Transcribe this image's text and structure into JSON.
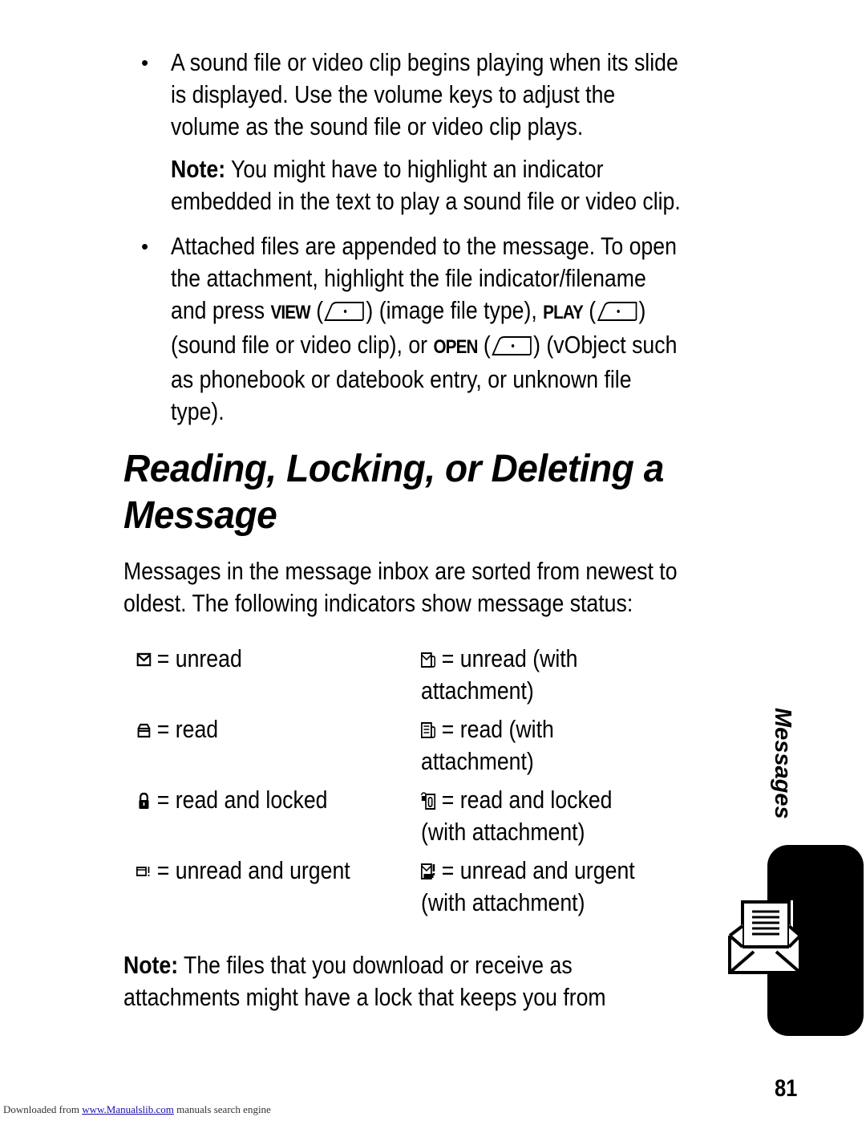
{
  "bullets": [
    {
      "lines": [
        "A sound file or video clip begins playing when its slide",
        "is displayed. Use the volume keys to adjust the",
        "volume as the sound file or video clip plays."
      ],
      "note_label": "Note:",
      "note_lines": [
        " You might have to highlight an indicator",
        "embedded in the text to play a sound file or video clip."
      ]
    },
    {
      "line1": "Attached files are appended to the message. To open",
      "line2": "the attachment, highlight the file indicator/filename",
      "line3_pre": "and press ",
      "view_key": "VIEW",
      "line3_mid": ") (image file type), ",
      "play_key": "PLAY",
      "line4_pre": "(sound file or video clip), or ",
      "open_key": "OPEN",
      "line4_post": ") (vObject such",
      "line5": "as phonebook or datebook entry, or unknown file",
      "line6": "type)."
    }
  ],
  "heading": {
    "line1": "Reading, Locking, or Deleting a",
    "line2": "Message"
  },
  "intro": [
    "Messages in the message inbox are sorted from newest to",
    "oldest. The following indicators show message status:"
  ],
  "indicators": [
    {
      "icon": "unread-envelope-icon",
      "label": "= unread"
    },
    {
      "icon": "unread-attachment-icon",
      "label": "= unread (with",
      "label2": "attachment)"
    },
    {
      "icon": "read-envelope-icon",
      "label": "= read"
    },
    {
      "icon": "read-attachment-icon",
      "label": "= read (with",
      "label2": "attachment)"
    },
    {
      "icon": "lock-icon",
      "label": "= read and locked"
    },
    {
      "icon": "locked-attachment-icon",
      "label": "= read and locked",
      "label2": "(with attachment)"
    },
    {
      "icon": "urgent-envelope-icon",
      "label": "= unread and urgent"
    },
    {
      "icon": "urgent-attachment-icon",
      "label": "= unread and urgent",
      "label2": "(with attachment)"
    }
  ],
  "bottom_note": {
    "label": "Note:",
    "line1": " The files that you download or receive as",
    "line2": "attachments might have a lock that keeps you from"
  },
  "side_tab": {
    "label": "Messages",
    "icon": "message-envelope-icon"
  },
  "page_number": "81",
  "footer": {
    "prefix": "Downloaded from ",
    "link": "www.Manualslib.com",
    "suffix": " manuals search engine"
  }
}
